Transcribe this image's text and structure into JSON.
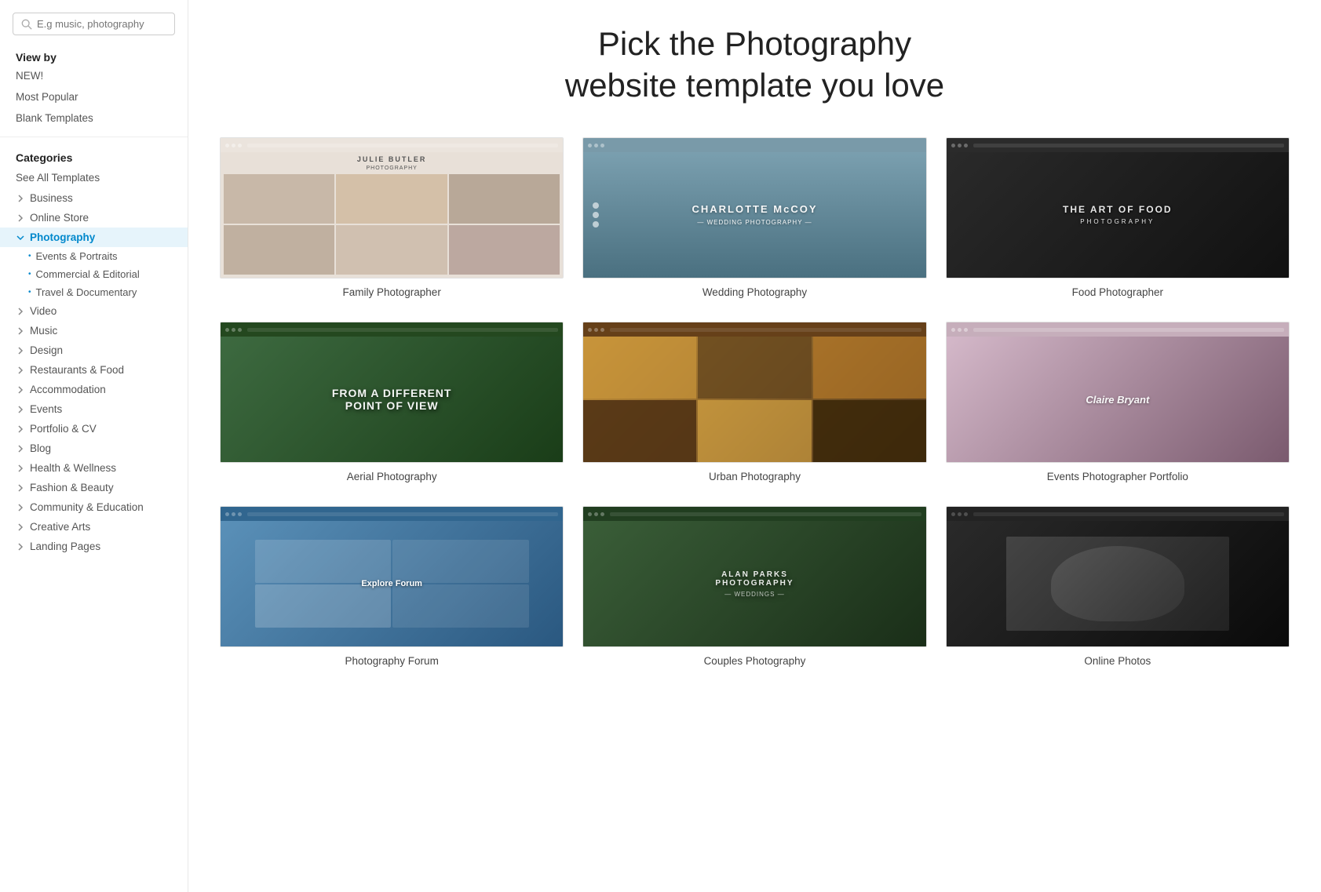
{
  "search": {
    "placeholder": "E.g music, photography"
  },
  "page_title_line1": "Pick the Photography",
  "page_title_line2": "website template you love",
  "sidebar": {
    "view_by_label": "View by",
    "new_label": "NEW!",
    "most_popular_label": "Most Popular",
    "blank_templates_label": "Blank Templates",
    "categories_label": "Categories",
    "see_all_label": "See All Templates",
    "categories": [
      {
        "name": "Business",
        "active": false
      },
      {
        "name": "Online Store",
        "active": false
      },
      {
        "name": "Photography",
        "active": true,
        "subs": [
          "Events & Portraits",
          "Commercial & Editorial",
          "Travel & Documentary"
        ]
      },
      {
        "name": "Video",
        "active": false
      },
      {
        "name": "Music",
        "active": false
      },
      {
        "name": "Design",
        "active": false
      },
      {
        "name": "Restaurants & Food",
        "active": false
      },
      {
        "name": "Accommodation",
        "active": false
      },
      {
        "name": "Events",
        "active": false
      },
      {
        "name": "Portfolio & CV",
        "active": false
      },
      {
        "name": "Blog",
        "active": false
      },
      {
        "name": "Health & Wellness",
        "active": false
      },
      {
        "name": "Fashion & Beauty",
        "active": false
      },
      {
        "name": "Community & Education",
        "active": false
      },
      {
        "name": "Creative Arts",
        "active": false
      },
      {
        "name": "Landing Pages",
        "active": false
      }
    ]
  },
  "templates": [
    {
      "id": "family",
      "name": "Family Photographer",
      "thumb_class": "thumb-family",
      "overlay": "JULIE BUTLER\nPHOTOGRAPHY"
    },
    {
      "id": "wedding",
      "name": "Wedding Photography",
      "thumb_class": "thumb-wedding",
      "overlay": "CHARLOTTE McCOY\n— WEDDING PHOTOGRAPHY —"
    },
    {
      "id": "food",
      "name": "Food Photographer",
      "thumb_class": "thumb-food",
      "overlay": "THE ART OF FOOD"
    },
    {
      "id": "aerial",
      "name": "Aerial Photography",
      "thumb_class": "thumb-aerial",
      "overlay": "FROM A DIFFERENT\nPOINT OF VIEW"
    },
    {
      "id": "urban",
      "name": "Urban Photography",
      "thumb_class": "thumb-urban",
      "overlay": ""
    },
    {
      "id": "events",
      "name": "Events Photographer Portfolio",
      "thumb_class": "thumb-events",
      "overlay": "Claire Bryant"
    },
    {
      "id": "forum",
      "name": "Photography Forum",
      "thumb_class": "thumb-forum",
      "overlay": "Explore Forum"
    },
    {
      "id": "couples",
      "name": "Couples Photography",
      "thumb_class": "thumb-couples",
      "overlay": "ALAN PARKS\nPHOTOGRAPHY"
    },
    {
      "id": "online",
      "name": "Online Photos",
      "thumb_class": "thumb-online",
      "overlay": ""
    }
  ]
}
